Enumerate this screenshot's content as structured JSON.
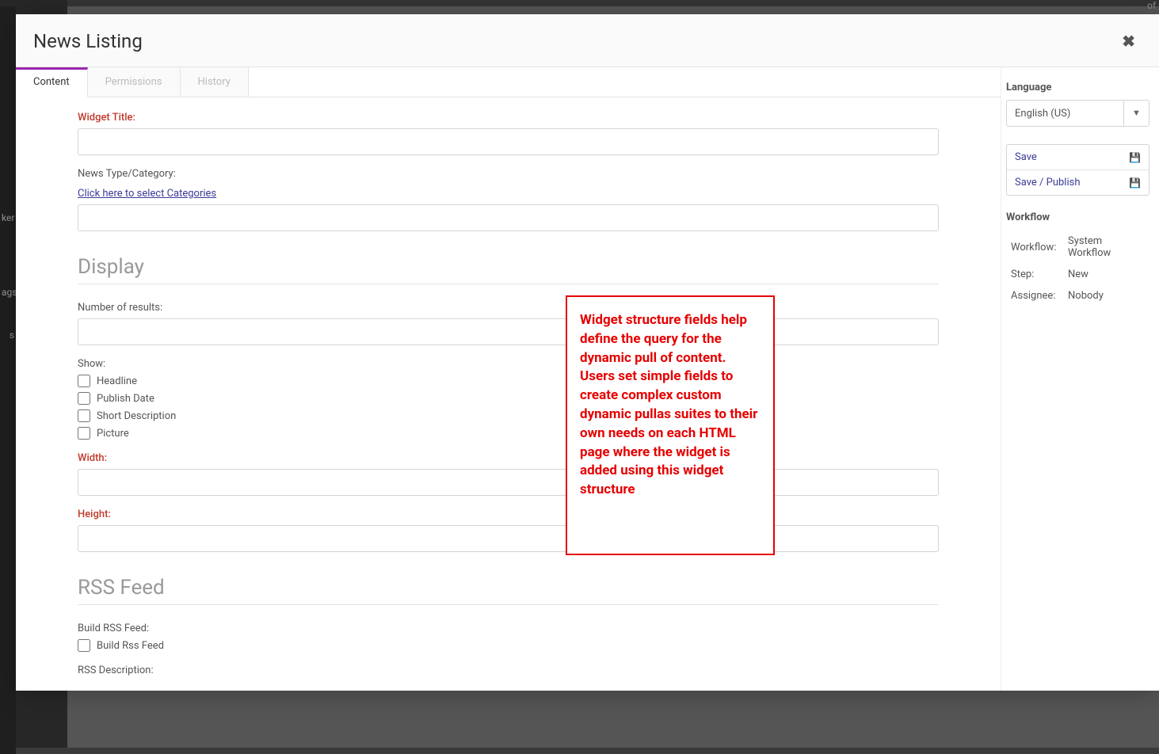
{
  "modal": {
    "title": "News Listing",
    "close_icon": "✖"
  },
  "tabs": [
    {
      "label": "Content",
      "active": true
    },
    {
      "label": "Permissions",
      "active": false
    },
    {
      "label": "History",
      "active": false
    }
  ],
  "form": {
    "widget_title_label": "Widget Title:",
    "news_type_label": "News Type/Category:",
    "categories_link": "Click here to select Categories",
    "display_heading": "Display",
    "num_results_label": "Number of results:",
    "show_label": "Show:",
    "show_options": [
      "Headline",
      "Publish Date",
      "Short Description",
      "Picture"
    ],
    "width_label": "Width:",
    "height_label": "Height:",
    "rss_heading": "RSS Feed",
    "build_rss_label": "Build RSS Feed:",
    "build_rss_option": "Build Rss Feed",
    "rss_desc_label": "RSS Description:"
  },
  "annotation": "Widget structure fields help define the query for the dynamic pull of content. Users set simple fields to create complex custom dynamic pullas suites to their own needs on each HTML page where the widget is added using this widget structure",
  "sidebar": {
    "language_heading": "Language",
    "language_value": "English (US)",
    "actions": {
      "save": "Save",
      "save_publish": "Save / Publish"
    },
    "workflow_heading": "Workflow",
    "workflow_rows": [
      {
        "k": "Workflow:",
        "v": "System Workflow"
      },
      {
        "k": "Step:",
        "v": "New"
      },
      {
        "k": "Assignee:",
        "v": "Nobody"
      }
    ]
  },
  "bg_snippets": {
    "of": "of",
    "s1": "ker",
    "s2": "ags",
    "s3": "s"
  }
}
